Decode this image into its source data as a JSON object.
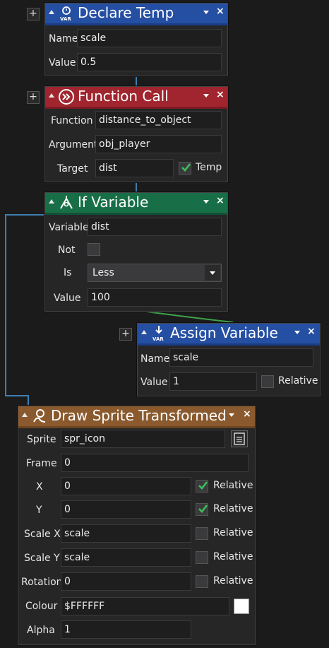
{
  "colors": {
    "declare_temp_header": "#254fa3",
    "function_call_header": "#a0252e",
    "if_variable_header": "#186f47",
    "assign_variable_header": "#254fa3",
    "draw_sprite_header": "#8a5a2e",
    "background": "#1b1b1c",
    "checkbox_tick": "#3cbf5a"
  },
  "declare_temp": {
    "title": "Declare Temp",
    "icon": "var-timer-icon",
    "add_label": "+",
    "close_label": "×",
    "name_label": "Name",
    "name_value": "scale",
    "value_label": "Value",
    "value_value": "0.5"
  },
  "function_call": {
    "title": "Function Call",
    "icon": "double-chevron-icon",
    "add_label": "+",
    "close_label": "×",
    "function_label": "Function",
    "function_value": "distance_to_object",
    "argument_label": "Argument",
    "argument_value": "obj_player",
    "target_label": "Target",
    "target_value": "dist",
    "temp_label": "Temp",
    "temp_checked": true
  },
  "if_variable": {
    "title": "If Variable",
    "icon": "branch-icon",
    "close_label": "×",
    "variable_label": "Variable",
    "variable_value": "dist",
    "not_label": "Not",
    "not_checked": false,
    "is_label": "Is",
    "is_value": "Less",
    "value_label": "Value",
    "value_value": "100"
  },
  "assign_variable": {
    "title": "Assign Variable",
    "icon": "var-download-icon",
    "add_label": "+",
    "close_label": "×",
    "name_label": "Name",
    "name_value": "scale",
    "value_label": "Value",
    "value_value": "1",
    "relative_label": "Relative",
    "relative_checked": false
  },
  "draw_sprite": {
    "title": "Draw Sprite Transformed",
    "icon": "sprite-brush-icon",
    "close_label": "×",
    "sprite_label": "Sprite",
    "sprite_value": "spr_icon",
    "frame_label": "Frame",
    "frame_value": "0",
    "x_label": "X",
    "x_value": "0",
    "x_relative": true,
    "y_label": "Y",
    "y_value": "0",
    "y_relative": true,
    "scalex_label": "Scale X",
    "scalex_value": "scale",
    "scalex_relative": false,
    "scaley_label": "Scale Y",
    "scaley_value": "scale",
    "scaley_relative": false,
    "rotation_label": "Rotation",
    "rotation_value": "0",
    "rotation_relative": false,
    "relative_label": "Relative",
    "colour_label": "Colour",
    "colour_value": "$FFFFFF",
    "alpha_label": "Alpha",
    "alpha_value": "1"
  }
}
